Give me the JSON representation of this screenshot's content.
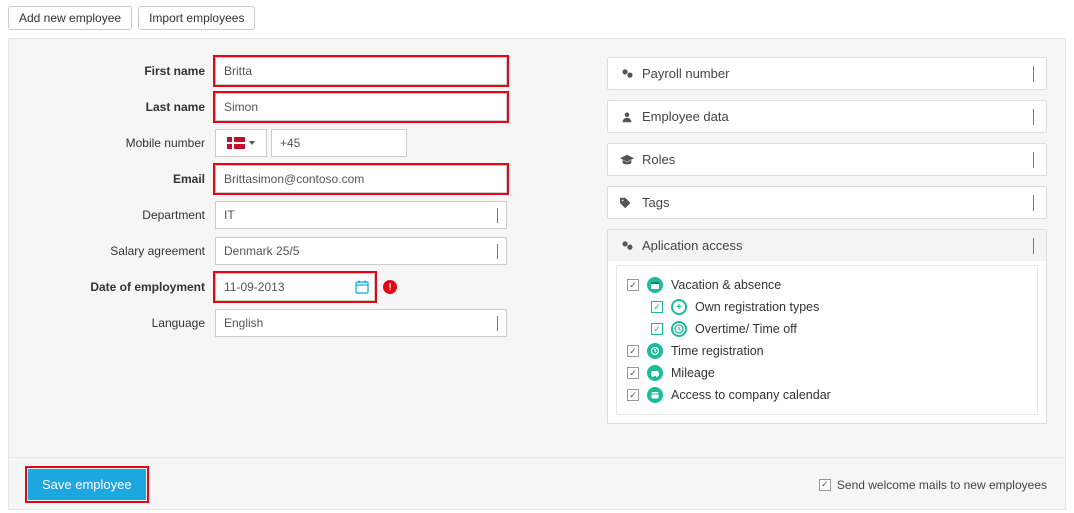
{
  "topButtons": {
    "add": "Add new employee",
    "import": "Import employees"
  },
  "form": {
    "labels": {
      "firstName": "First name",
      "lastName": "Last name",
      "mobile": "Mobile number",
      "email": "Email",
      "department": "Department",
      "salary": "Salary agreement",
      "date": "Date of employment",
      "language": "Language"
    },
    "values": {
      "firstName": "Britta",
      "lastName": "Simon",
      "phonePrefix": "+45",
      "email": "Brittasimon@contoso.com",
      "department": "IT",
      "salary": "Denmark 25/5",
      "date": "11-09-2013",
      "language": "English"
    }
  },
  "panels": {
    "payroll": "Payroll number",
    "employeeData": "Employee data",
    "roles": "Roles",
    "tags": "Tags",
    "appAccess": "Aplication access"
  },
  "access": {
    "vacation": "Vacation & absence",
    "ownReg": "Own registration types",
    "overtime": "Overtime/ Time off",
    "timeReg": "Time registration",
    "mileage": "Mileage",
    "calendar": "Access to company calendar"
  },
  "footer": {
    "save": "Save employee",
    "welcome": "Send welcome mails to new employees"
  }
}
